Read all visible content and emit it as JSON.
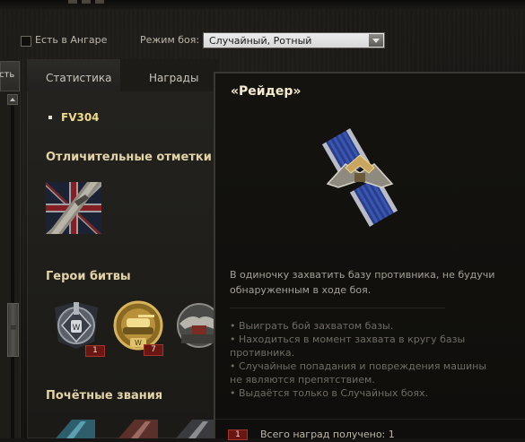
{
  "filter": {
    "in_hangar_label": "Есть в Ангаре",
    "battle_mode_label": "Режим боя:",
    "battle_mode_value": "Случайный, Ротный"
  },
  "left_tab_fragment": "сть",
  "tabs": [
    {
      "label": "Статистика"
    },
    {
      "label": "Награды"
    }
  ],
  "tank_name": "FV304",
  "sections": {
    "marks_title": "Отличительные отметки",
    "heroes_title": "Герои битвы",
    "ranks_title": "Почётные звания"
  },
  "hero_medals": [
    {
      "icon": "sniper-medal-icon",
      "count": "1"
    },
    {
      "icon": "tank-medal-icon",
      "count": "7"
    },
    {
      "icon": "raider-medal-icon",
      "count": ""
    }
  ],
  "tooltip": {
    "title": "«Рейдер»",
    "description": "В одиночку захватить базу противника, не будучи обнаруженным в ходе боя.",
    "conditions": [
      "• Выиграть бой захватом базы.",
      "• Находиться в момент захвата в кругу базы противника.",
      "• Случайные попадания и повреждения машины не являются препятствием.",
      "• Выдаётся только в Случайных боях."
    ],
    "total_count_badge": "1",
    "total_label": "Всего наград получено: 1"
  },
  "colors": {
    "accent_gold": "#f1d98a",
    "section_title": "#e3d3a8",
    "badge_red": "#6a1612"
  }
}
